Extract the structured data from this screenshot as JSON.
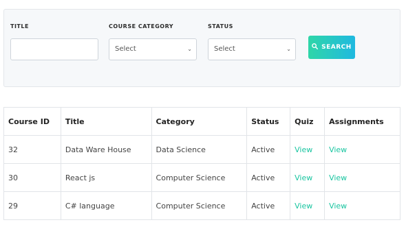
{
  "filters": {
    "title_label": "TITLE",
    "title_value": "",
    "category_label": "COURSE CATEGORY",
    "category_selected": "Select",
    "status_label": "STATUS",
    "status_selected": "Select",
    "search_button": "SEARCH",
    "search_icon": "search-icon"
  },
  "table": {
    "columns": [
      "Course ID",
      "Title",
      "Category",
      "Status",
      "Quiz",
      "Assignments"
    ],
    "rows": [
      {
        "id": "32",
        "title": "Data Ware House",
        "category": "Data Science",
        "status": "Active",
        "quiz": "View",
        "assignments": "View"
      },
      {
        "id": "30",
        "title": "React js",
        "category": "Computer Science",
        "status": "Active",
        "quiz": "View",
        "assignments": "View"
      },
      {
        "id": "29",
        "title": "C# language",
        "category": "Computer Science",
        "status": "Active",
        "quiz": "View",
        "assignments": "View"
      }
    ]
  },
  "colors": {
    "accent_link": "#19c5a0",
    "button_gradient_start": "#2fd6a8",
    "button_gradient_end": "#1fb9e0"
  }
}
